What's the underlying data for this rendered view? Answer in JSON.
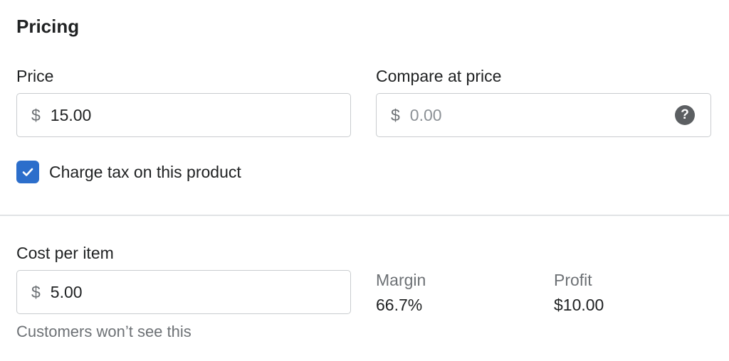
{
  "section": {
    "title": "Pricing"
  },
  "price": {
    "label": "Price",
    "currency_symbol": "$",
    "value": "15.00"
  },
  "compare_at_price": {
    "label": "Compare at price",
    "currency_symbol": "$",
    "placeholder": "0.00",
    "help_icon": "question-circle-icon",
    "help_glyph": "?"
  },
  "charge_tax": {
    "label": "Charge tax on this product",
    "checked": true,
    "check_color": "#2c6ecb"
  },
  "cost_per_item": {
    "label": "Cost per item",
    "currency_symbol": "$",
    "value": "5.00",
    "help_text": "Customers won’t see this"
  },
  "margin": {
    "label": "Margin",
    "value": "66.7%"
  },
  "profit": {
    "label": "Profit",
    "value": "$10.00"
  }
}
